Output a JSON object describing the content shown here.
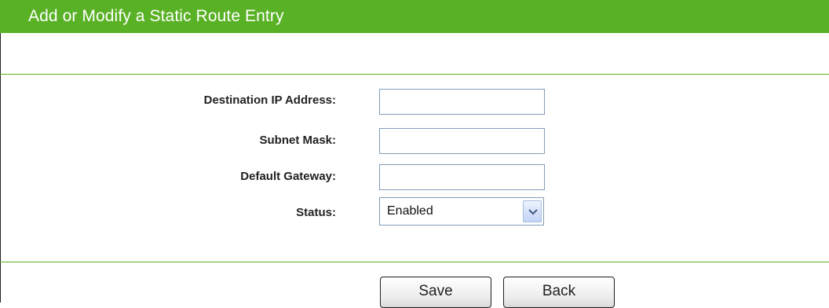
{
  "header": {
    "title": "Add or Modify a Static Route Entry"
  },
  "form": {
    "destination_label": "Destination IP Address:",
    "destination_value": "",
    "subnet_label": "Subnet Mask:",
    "subnet_value": "",
    "gateway_label": "Default Gateway:",
    "gateway_value": "",
    "status_label": "Status:",
    "status_value": "Enabled"
  },
  "buttons": {
    "save": "Save",
    "back": "Back"
  },
  "colors": {
    "accent": "#59b125"
  }
}
